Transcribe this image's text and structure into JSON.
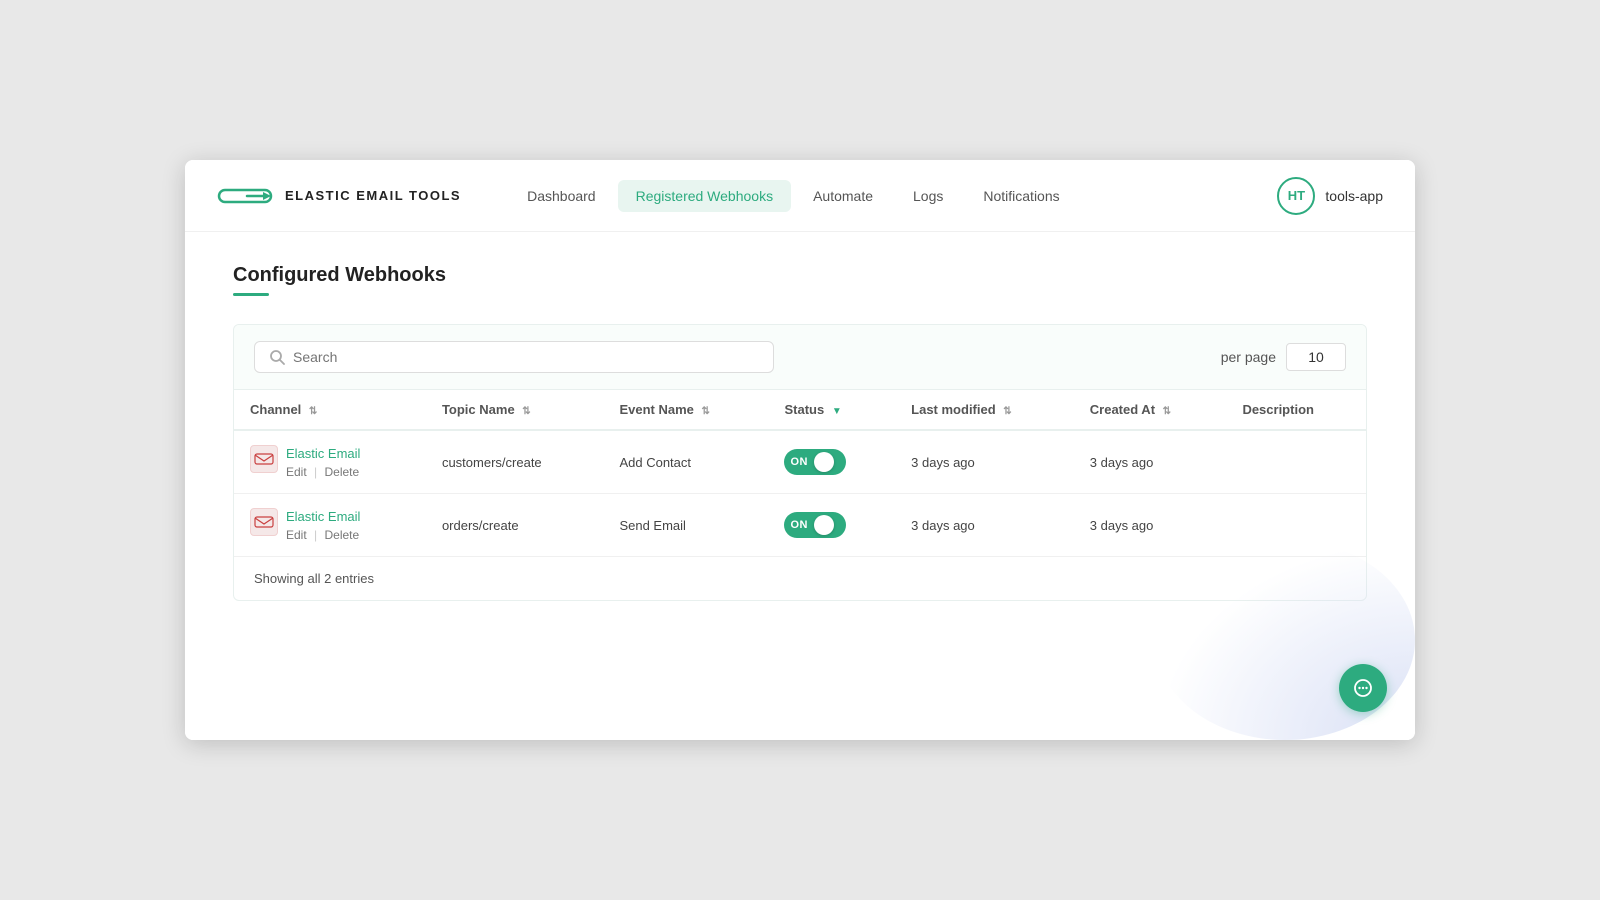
{
  "navbar": {
    "logo_text": "ELASTIC EMAIL TOOLS",
    "avatar_initials": "HT",
    "user_name": "tools-app",
    "nav_links": [
      {
        "id": "dashboard",
        "label": "Dashboard",
        "active": false
      },
      {
        "id": "registered-webhooks",
        "label": "Registered Webhooks",
        "active": true
      },
      {
        "id": "automate",
        "label": "Automate",
        "active": false
      },
      {
        "id": "logs",
        "label": "Logs",
        "active": false
      },
      {
        "id": "notifications",
        "label": "Notifications",
        "active": false
      }
    ]
  },
  "page": {
    "title": "Configured Webhooks"
  },
  "toolbar": {
    "search_placeholder": "Search",
    "per_page_label": "per page",
    "per_page_value": "10"
  },
  "table": {
    "columns": [
      {
        "id": "channel",
        "label": "Channel"
      },
      {
        "id": "topic_name",
        "label": "Topic Name"
      },
      {
        "id": "event_name",
        "label": "Event Name"
      },
      {
        "id": "status",
        "label": "Status"
      },
      {
        "id": "last_modified",
        "label": "Last modified"
      },
      {
        "id": "created_at",
        "label": "Created At"
      },
      {
        "id": "description",
        "label": "Description"
      }
    ],
    "rows": [
      {
        "channel_name": "Elastic Email",
        "channel_icon": "EE",
        "topic_name": "customers/create",
        "event_name": "Add Contact",
        "status": "ON",
        "last_modified": "3 days ago",
        "created_at": "3 days ago",
        "description": "",
        "edit_label": "Edit",
        "delete_label": "Delete"
      },
      {
        "channel_name": "Elastic Email",
        "channel_icon": "EE",
        "topic_name": "orders/create",
        "event_name": "Send Email",
        "status": "ON",
        "last_modified": "3 days ago",
        "created_at": "3 days ago",
        "description": "",
        "edit_label": "Edit",
        "delete_label": "Delete"
      }
    ]
  },
  "footer": {
    "showing_text": "Showing all 2 entries"
  }
}
